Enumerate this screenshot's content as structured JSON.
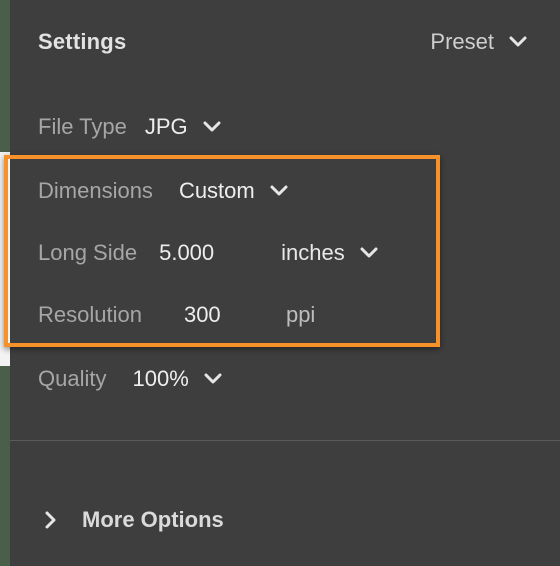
{
  "header": {
    "title": "Settings",
    "preset_label": "Preset"
  },
  "file_type": {
    "label": "File Type",
    "value": "JPG"
  },
  "dimensions": {
    "label": "Dimensions",
    "value": "Custom"
  },
  "long_side": {
    "label": "Long Side",
    "value": "5.000",
    "unit": "inches"
  },
  "resolution": {
    "label": "Resolution",
    "value": "300",
    "unit": "ppi"
  },
  "quality": {
    "label": "Quality",
    "value": "100%"
  },
  "more_options": {
    "label": "More Options"
  },
  "colors": {
    "panel_bg": "#3e3e3e",
    "highlight_border": "#f7922b",
    "label_text": "#a6a6a6",
    "value_text": "#eeeeee"
  },
  "icons": {
    "dropdown": "chevron-down-icon",
    "expand": "chevron-right-icon"
  }
}
